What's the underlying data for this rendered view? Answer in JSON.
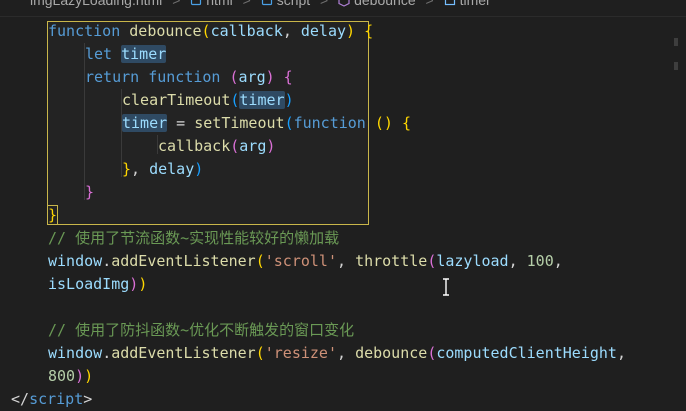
{
  "breadcrumb": {
    "items": [
      "imgLazyLoading.html",
      "html",
      "script",
      "debounce",
      "timer"
    ],
    "separator": ">"
  },
  "code": {
    "l1": [
      "function",
      "debounce",
      "(",
      "callback",
      ", ",
      "delay",
      ")",
      " {"
    ],
    "l2": [
      "let",
      "timer"
    ],
    "l3": [
      "return",
      "function",
      " (",
      "arg",
      ")",
      " {"
    ],
    "l4": [
      "clearTimeout",
      "(",
      "timer",
      ")"
    ],
    "l5": [
      "timer",
      " = ",
      "setTimeout",
      "(",
      "function",
      " ()",
      " {"
    ],
    "l6": [
      "callback",
      "(",
      "arg",
      ")"
    ],
    "l7": [
      "}",
      ", ",
      "delay",
      ")"
    ],
    "l8": [
      "}"
    ],
    "l9": [
      "}"
    ],
    "l10": [
      "// 使用了节流函数~实现性能较好的懒加载"
    ],
    "l11": [
      "window",
      ".",
      "addEventListener",
      "(",
      "'scroll'",
      ", ",
      "throttle",
      "(",
      "lazyload",
      ", ",
      "100",
      ","
    ],
    "l12": [
      "isLoadImg",
      ")",
      ")"
    ],
    "l13": [
      "// 使用了防抖函数~优化不断触发的窗口变化"
    ],
    "l14": [
      "window",
      ".",
      "addEventListener",
      "(",
      "'resize'",
      ", ",
      "debounce",
      "(",
      "computedClientHeight",
      ","
    ],
    "l15": [
      "800",
      ")",
      ")"
    ],
    "l16": [
      "</",
      "script",
      ">"
    ]
  },
  "colors": {
    "background": "#1f1f1f",
    "keyword": "#569cd6",
    "function": "#dcdcaa",
    "variable": "#9cdcfe",
    "string": "#ce9178",
    "number": "#b5cea8",
    "comment": "#6a9955",
    "bracket1": "#ffd700",
    "bracket2": "#da70d6",
    "bracket3": "#179fff"
  },
  "icons": [
    "html-file-icon",
    "tag-icon",
    "function-cube-icon",
    "variable-icon",
    "text-cursor-icon"
  ]
}
